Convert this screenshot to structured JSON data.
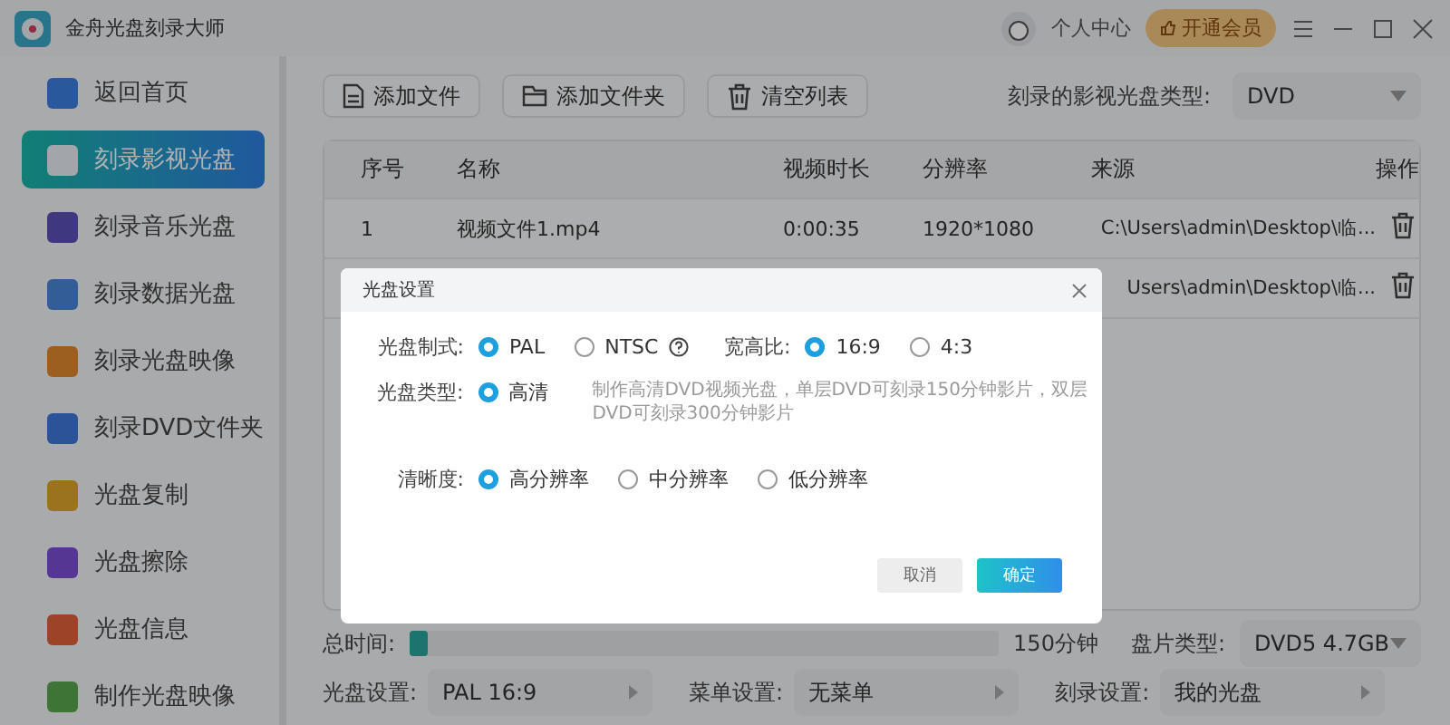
{
  "app": {
    "title": "金舟光盘刻录大师",
    "user_label": "个人中心",
    "vip_button": "开通会员"
  },
  "sidebar": {
    "items": [
      {
        "label": "返回首页",
        "selected": false
      },
      {
        "label": "刻录影视光盘",
        "selected": true
      },
      {
        "label": "刻录音乐光盘",
        "selected": false
      },
      {
        "label": "刻录数据光盘",
        "selected": false
      },
      {
        "label": "刻录光盘映像",
        "selected": false
      },
      {
        "label": "刻录DVD文件夹",
        "selected": false
      },
      {
        "label": "光盘复制",
        "selected": false
      },
      {
        "label": "光盘擦除",
        "selected": false
      },
      {
        "label": "光盘信息",
        "selected": false
      },
      {
        "label": "制作光盘映像",
        "selected": false
      }
    ]
  },
  "toolbar": {
    "buttons": [
      {
        "label": "添加文件",
        "kind": "file"
      },
      {
        "label": "添加文件夹",
        "kind": "folder"
      },
      {
        "label": "清空列表",
        "kind": "trash"
      }
    ],
    "disc_type_label": "刻录的影视光盘类型:",
    "disc_type_value": "DVD"
  },
  "table": {
    "columns": [
      "序号",
      "名称",
      "视频时长",
      "分辨率",
      "来源",
      "操作"
    ],
    "rows": [
      {
        "number": "1",
        "name": "视频文件1.mp4",
        "duration": "0:00:35",
        "resolution": "1920*1080",
        "source": "C:\\Users\\admin\\Desktop\\临..."
      },
      {
        "source": "Users\\admin\\Desktop\\临..."
      }
    ]
  },
  "footer": {
    "total_label": "总时间:",
    "capacity": {
      "level": 0.03
    },
    "capacity_text": "150分钟",
    "media_label": "盘片类型:",
    "media_value": "DVD5 4.7GB",
    "settings": [
      {
        "label": "光盘设置:",
        "value": "PAL 16:9"
      },
      {
        "label": "菜单设置:",
        "value": "无菜单"
      },
      {
        "label": "刻录设置:",
        "value": "我的光盘"
      }
    ]
  },
  "dialog": {
    "title": "光盘设置",
    "format": {
      "label": "光盘制式:",
      "options": [
        {
          "label": "PAL",
          "selected": true,
          "help": false
        },
        {
          "label": "NTSC",
          "selected": false,
          "help": true
        }
      ]
    },
    "aspect": {
      "label": "宽高比:",
      "options": [
        {
          "label": "16:9",
          "selected": true
        },
        {
          "label": "4:3",
          "selected": false
        }
      ]
    },
    "disc_kind": {
      "label": "光盘类型:",
      "options": [
        {
          "label": "高清",
          "selected": true
        }
      ],
      "description": "制作高清DVD视频光盘，单层DVD可刻录150分钟影片，双层DVD可刻录300分钟影片"
    },
    "clarity": {
      "label": "清晰度:",
      "options": [
        {
          "label": "高分辨率",
          "selected": true
        },
        {
          "label": "中分辨率",
          "selected": false
        },
        {
          "label": "低分辨率",
          "selected": false
        }
      ]
    },
    "cancel": "取消",
    "confirm": "确定"
  }
}
